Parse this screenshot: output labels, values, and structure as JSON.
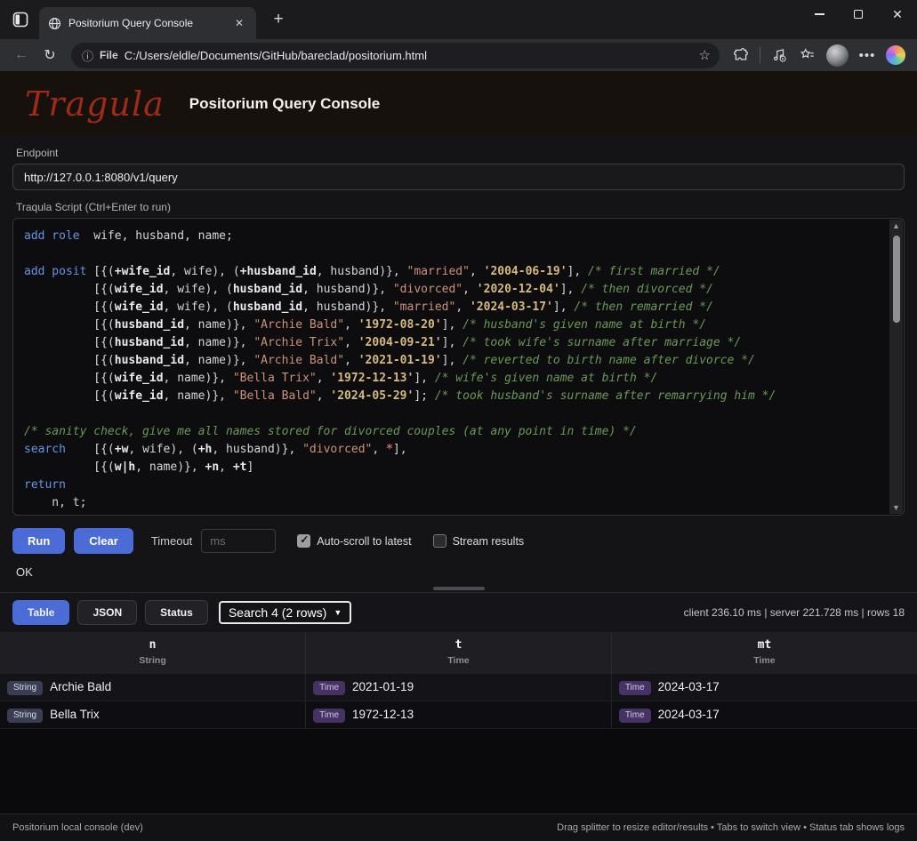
{
  "browser": {
    "tab_title": "Positorium Query Console",
    "url_scheme": "File",
    "url": "C:/Users/eldle/Documents/GitHub/bareclad/positorium.html"
  },
  "header": {
    "logo": "Tragula",
    "title": "Positorium Query Console"
  },
  "endpoint": {
    "label": "Endpoint",
    "value": "http://127.0.0.1:8080/v1/query"
  },
  "editor": {
    "label": "Traqula Script (Ctrl+Enter to run)",
    "lines": [
      [
        [
          "k",
          "add role"
        ],
        [
          "p",
          "  wife, husband, name;"
        ]
      ],
      [],
      [
        [
          "k",
          "add posit"
        ],
        [
          "p",
          " [{("
        ],
        [
          "b",
          "+wife_id"
        ],
        [
          "p",
          ", wife), ("
        ],
        [
          "b",
          "+husband_id"
        ],
        [
          "p",
          ", husband)}, "
        ],
        [
          "s",
          "\"married\""
        ],
        [
          "p",
          ", "
        ],
        [
          "t",
          "'2004-06-19'"
        ],
        [
          "p",
          "], "
        ],
        [
          "c",
          "/* first married */"
        ]
      ],
      [
        [
          "p",
          "          [{("
        ],
        [
          "b",
          "wife_id"
        ],
        [
          "p",
          ", wife), ("
        ],
        [
          "b",
          "husband_id"
        ],
        [
          "p",
          ", husband)}, "
        ],
        [
          "s",
          "\"divorced\""
        ],
        [
          "p",
          ", "
        ],
        [
          "t",
          "'2020-12-04'"
        ],
        [
          "p",
          "], "
        ],
        [
          "c",
          "/* then divorced */"
        ]
      ],
      [
        [
          "p",
          "          [{("
        ],
        [
          "b",
          "wife_id"
        ],
        [
          "p",
          ", wife), ("
        ],
        [
          "b",
          "husband_id"
        ],
        [
          "p",
          ", husband)}, "
        ],
        [
          "s",
          "\"married\""
        ],
        [
          "p",
          ", "
        ],
        [
          "t",
          "'2024-03-17'"
        ],
        [
          "p",
          "], "
        ],
        [
          "c",
          "/* then remarried */"
        ]
      ],
      [
        [
          "p",
          "          [{("
        ],
        [
          "b",
          "husband_id"
        ],
        [
          "p",
          ", name)}, "
        ],
        [
          "s",
          "\"Archie Bald\""
        ],
        [
          "p",
          ", "
        ],
        [
          "t",
          "'1972-08-20'"
        ],
        [
          "p",
          "], "
        ],
        [
          "c",
          "/* husband's given name at birth */"
        ]
      ],
      [
        [
          "p",
          "          [{("
        ],
        [
          "b",
          "husband_id"
        ],
        [
          "p",
          ", name)}, "
        ],
        [
          "s",
          "\"Archie Trix\""
        ],
        [
          "p",
          ", "
        ],
        [
          "t",
          "'2004-09-21'"
        ],
        [
          "p",
          "], "
        ],
        [
          "c",
          "/* took wife's surname after marriage */"
        ]
      ],
      [
        [
          "p",
          "          [{("
        ],
        [
          "b",
          "husband_id"
        ],
        [
          "p",
          ", name)}, "
        ],
        [
          "s",
          "\"Archie Bald\""
        ],
        [
          "p",
          ", "
        ],
        [
          "t",
          "'2021-01-19'"
        ],
        [
          "p",
          "], "
        ],
        [
          "c",
          "/* reverted to birth name after divorce */"
        ]
      ],
      [
        [
          "p",
          "          [{("
        ],
        [
          "b",
          "wife_id"
        ],
        [
          "p",
          ", name)}, "
        ],
        [
          "s",
          "\"Bella Trix\""
        ],
        [
          "p",
          ", "
        ],
        [
          "t",
          "'1972-12-13'"
        ],
        [
          "p",
          "], "
        ],
        [
          "c",
          "/* wife's given name at birth */"
        ]
      ],
      [
        [
          "p",
          "          [{("
        ],
        [
          "b",
          "wife_id"
        ],
        [
          "p",
          ", name)}, "
        ],
        [
          "s",
          "\"Bella Bald\""
        ],
        [
          "p",
          ", "
        ],
        [
          "t",
          "'2024-05-29'"
        ],
        [
          "p",
          "]; "
        ],
        [
          "c",
          "/* took husband's surname after remarrying him */"
        ]
      ],
      [],
      [
        [
          "c",
          "/* sanity check, give me all names stored for divorced couples (at any point in time) */"
        ]
      ],
      [
        [
          "k",
          "search"
        ],
        [
          "p",
          "    [{("
        ],
        [
          "b",
          "+w"
        ],
        [
          "p",
          ", wife), ("
        ],
        [
          "b",
          "+h"
        ],
        [
          "p",
          ", husband)}, "
        ],
        [
          "s",
          "\"divorced\""
        ],
        [
          "p",
          ", "
        ],
        [
          "r",
          "*"
        ],
        [
          "p",
          "],"
        ]
      ],
      [
        [
          "p",
          "          [{("
        ],
        [
          "b",
          "w|h"
        ],
        [
          "p",
          ", name)}, "
        ],
        [
          "b",
          "+n"
        ],
        [
          "p",
          ", "
        ],
        [
          "b",
          "+t"
        ],
        [
          "p",
          "]"
        ]
      ],
      [
        [
          "k",
          "return"
        ]
      ],
      [
        [
          "p",
          "    n, t;"
        ]
      ]
    ]
  },
  "controls": {
    "run_label": "Run",
    "clear_label": "Clear",
    "timeout_label": "Timeout",
    "timeout_placeholder": "ms",
    "autoscroll_label": "Auto-scroll to latest",
    "autoscroll_checked": true,
    "stream_label": "Stream results",
    "stream_checked": false,
    "status": "OK"
  },
  "results": {
    "tabs": [
      {
        "label": "Table",
        "active": true
      },
      {
        "label": "JSON",
        "active": false
      },
      {
        "label": "Status",
        "active": false
      }
    ],
    "selector_value": "Search 4 (2 rows)",
    "stats": "client 236.10 ms | server 221.728 ms | rows 18",
    "table": {
      "columns": [
        {
          "name": "n",
          "type": "String"
        },
        {
          "name": "t",
          "type": "Time"
        },
        {
          "name": "mt",
          "type": "Time"
        }
      ],
      "rows": [
        [
          {
            "badge": "String",
            "value": "Archie Bald"
          },
          {
            "badge": "Time",
            "value": "2021-01-19"
          },
          {
            "badge": "Time",
            "value": "2024-03-17"
          }
        ],
        [
          {
            "badge": "String",
            "value": "Bella Trix"
          },
          {
            "badge": "Time",
            "value": "1972-12-13"
          },
          {
            "badge": "Time",
            "value": "2024-03-17"
          }
        ]
      ]
    }
  },
  "footer": {
    "left": "Positorium local console (dev)",
    "right": "Drag splitter to resize editor/results • Tabs to switch view • Status tab shows logs"
  },
  "colors": {
    "accent_blue": "#4b6cd6",
    "logo_red": "#9e2a18",
    "keyword": "#6494e4",
    "string": "#ce9178",
    "date_literal": "#d7ba7d",
    "comment": "#6a9955",
    "badge_string_bg": "#393e52",
    "badge_time_bg": "#463263"
  }
}
